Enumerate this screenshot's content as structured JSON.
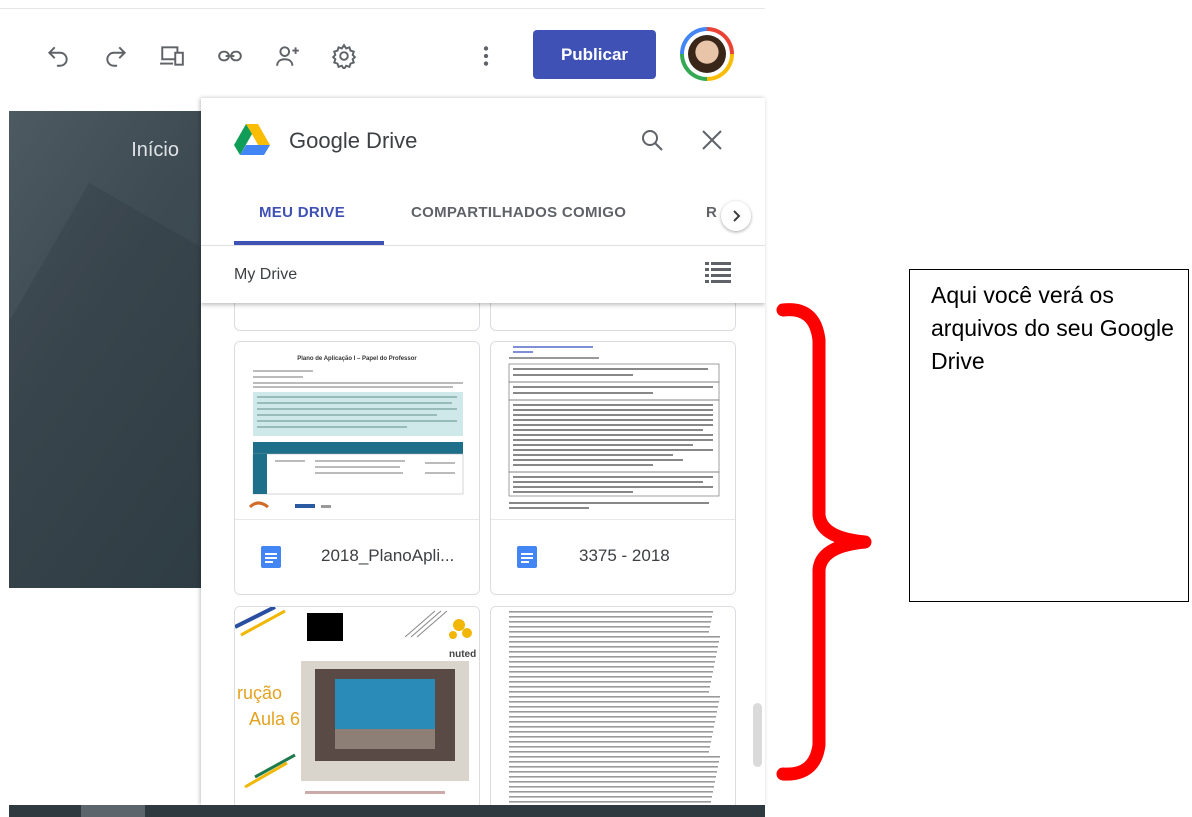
{
  "toolbar": {
    "publish_label": "Publicar",
    "icons": [
      "undo-icon",
      "redo-icon",
      "preview-devices-icon",
      "link-icon",
      "add-person-icon",
      "gear-icon",
      "more-vert-icon"
    ]
  },
  "left_panel": {
    "nav_label": "Início"
  },
  "drive_panel": {
    "title": "Google Drive",
    "tabs": [
      {
        "label": "MEU DRIVE",
        "active": true
      },
      {
        "label": "COMPARTILHADOS COMIGO",
        "active": false
      },
      {
        "label": "R",
        "active": false
      }
    ],
    "breadcrumb": "My Drive",
    "files": [
      {
        "name": "2018_PlanoApli...",
        "type": "doc",
        "thumb_title": "Plano de Aplicação I – Papel do Professor"
      },
      {
        "name": "3375 - 2018",
        "type": "doc"
      },
      {
        "name": "",
        "type": "slides",
        "thumb_text_1": "rução",
        "thumb_text_2": "Aula 6",
        "thumb_brand": "nuted"
      },
      {
        "name": "",
        "type": "doc"
      }
    ]
  },
  "annotation": {
    "text": "Aqui você verá os arquivos do seu Google Drive"
  },
  "colors": {
    "accent": "#3f51b5",
    "brace": "#ff0000",
    "doc_blue": "#4285f4"
  }
}
